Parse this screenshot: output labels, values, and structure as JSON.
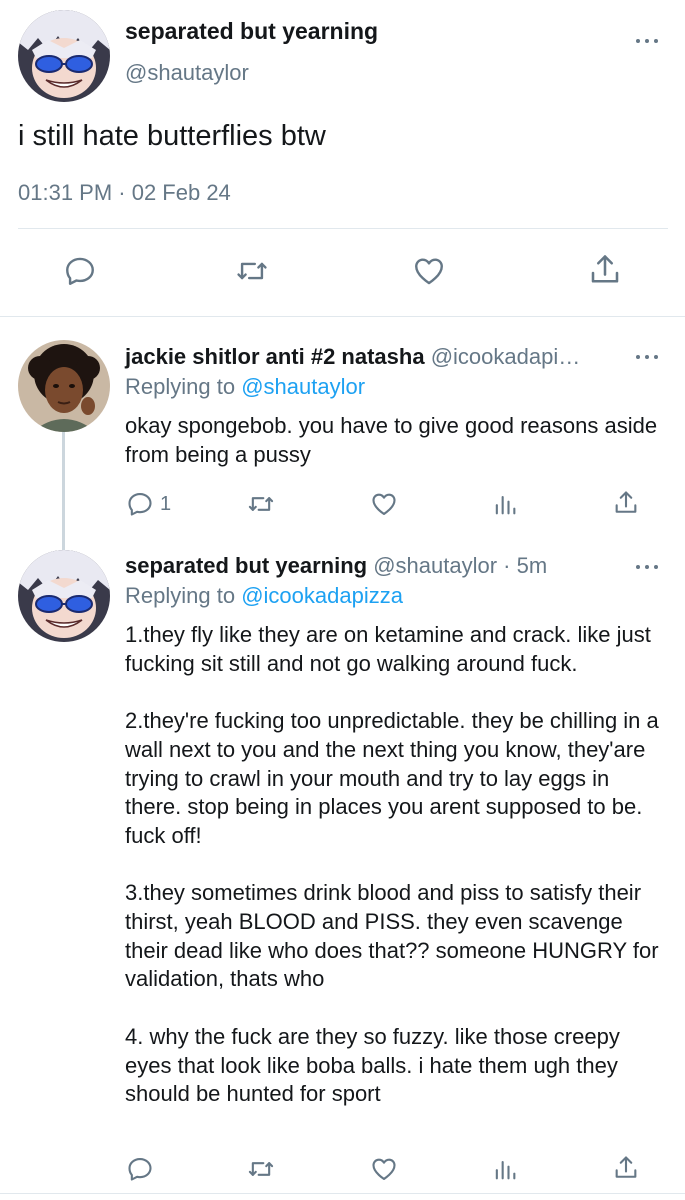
{
  "main_tweet": {
    "display_name": "separated but yearning",
    "handle": "@shautaylor",
    "text": "i still hate butterflies btw",
    "timestamp": "01:31 PM · 02 Feb 24",
    "avatar_icon": "anime-avatar-icon",
    "actions": [
      "reply-icon",
      "retweet-icon",
      "like-icon",
      "share-icon"
    ]
  },
  "replies": [
    {
      "display_name": "jackie shitlor anti #2 natasha",
      "handle": "@icookadapi…",
      "replying_label": "Replying to",
      "replying_to": "@shautaylor",
      "text": "okay spongebob. you have to give good reasons aside from being a pussy",
      "reply_count": "1",
      "avatar_icon": "person-avatar-icon"
    },
    {
      "display_name": "separated but yearning",
      "handle": "@shautaylor",
      "time": "· 5m",
      "replying_label": "Replying to",
      "replying_to": "@icookadapizza",
      "text": "1.they fly like they are on ketamine and crack. like just fucking sit still and not go walking around fuck.\n\n2.they're fucking too unpredictable. they be chilling in a wall next to you  and the next thing you know, they'are trying to crawl in your mouth and try to lay eggs in there. stop being in places you arent supposed to be. fuck off!\n\n3.they sometimes drink blood and piss to satisfy their thirst, yeah BLOOD and PISS. they even scavenge their dead like who does that?? someone HUNGRY for validation, thats who\n\n4. why the fuck are they so fuzzy. like those creepy eyes that look like boba balls. i hate them ugh they should be hunted for sport",
      "avatar_icon": "anime-avatar-icon"
    }
  ],
  "colors": {
    "text": "#14171a",
    "muted": "#657786",
    "link": "#1da1f2",
    "divider": "#e1e8ed"
  }
}
